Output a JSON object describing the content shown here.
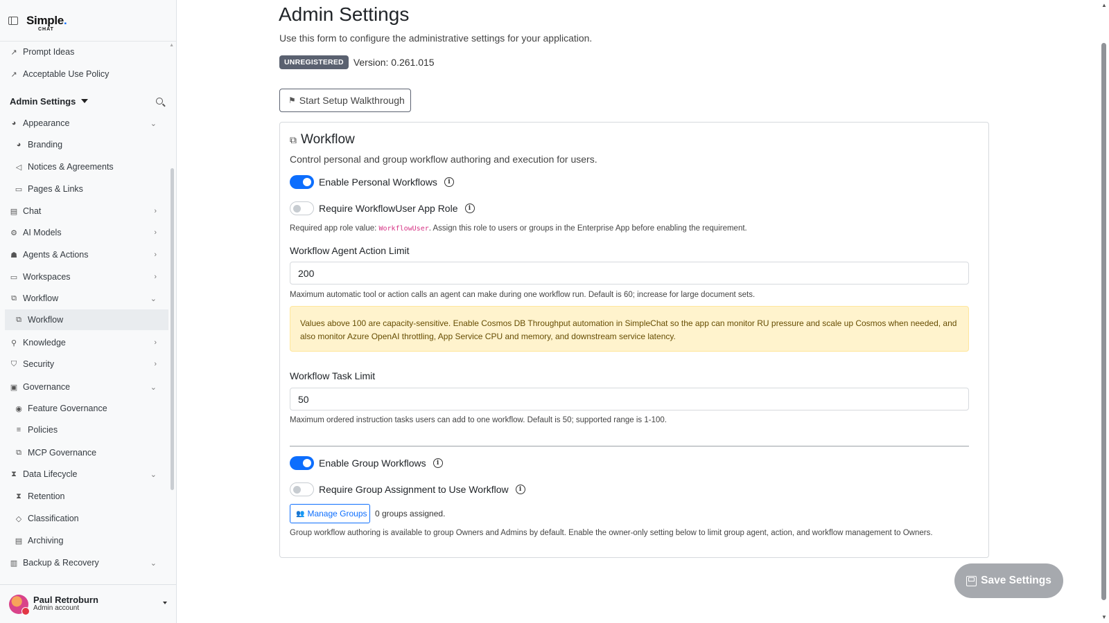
{
  "brand": {
    "line1": "Simple",
    "line2": "CHAT"
  },
  "sidebar": {
    "top_links": [
      {
        "label": "Prompt Ideas",
        "icon": "external-link-icon"
      },
      {
        "label": "Acceptable Use Policy",
        "icon": "external-link-icon"
      }
    ],
    "section_title": "Admin Settings",
    "items": [
      {
        "label": "Appearance",
        "icon": "palette-icon",
        "chevron": "down"
      },
      {
        "label": "Branding",
        "icon": "palette-icon"
      },
      {
        "label": "Notices & Agreements",
        "icon": "megaphone-icon"
      },
      {
        "label": "Pages & Links",
        "icon": "pages-icon"
      },
      {
        "label": "Chat",
        "icon": "chat-icon",
        "chevron": "right"
      },
      {
        "label": "AI Models",
        "icon": "cpu-icon",
        "chevron": "right"
      },
      {
        "label": "Agents & Actions",
        "icon": "robot-icon",
        "chevron": "right"
      },
      {
        "label": "Workspaces",
        "icon": "folder-icon",
        "chevron": "right"
      },
      {
        "label": "Workflow",
        "icon": "workflow-icon",
        "chevron": "down"
      },
      {
        "label": "Workflow",
        "icon": "workflow-icon",
        "active": true
      },
      {
        "label": "Knowledge",
        "icon": "search-icon",
        "chevron": "right"
      },
      {
        "label": "Security",
        "icon": "shield-icon",
        "chevron": "right"
      },
      {
        "label": "Governance",
        "icon": "clipboard-icon",
        "chevron": "down"
      },
      {
        "label": "Feature Governance",
        "icon": "broadcast-icon"
      },
      {
        "label": "Policies",
        "icon": "sliders-icon"
      },
      {
        "label": "MCP Governance",
        "icon": "workflow-icon"
      },
      {
        "label": "Data Lifecycle",
        "icon": "hourglass-icon",
        "chevron": "down"
      },
      {
        "label": "Retention",
        "icon": "hourglass-icon"
      },
      {
        "label": "Classification",
        "icon": "tag-icon"
      },
      {
        "label": "Archiving",
        "icon": "archive-icon"
      },
      {
        "label": "Backup & Recovery",
        "icon": "database-icon",
        "chevron": "down"
      }
    ]
  },
  "user": {
    "name": "Paul Retroburn",
    "role": "Admin account"
  },
  "page": {
    "title": "Admin Settings",
    "description": "Use this form to configure the administrative settings for your application.",
    "badge": "UNREGISTERED",
    "version": "Version: 0.261.015",
    "walkthrough_label": "Start Setup Walkthrough"
  },
  "workflow_card": {
    "title": "Workflow",
    "description": "Control personal and group workflow authoring and execution for users.",
    "enable_personal": {
      "label": "Enable Personal Workflows",
      "checked": true
    },
    "require_role": {
      "label": "Require WorkflowUser App Role",
      "checked": false
    },
    "role_help_prefix": "Required app role value: ",
    "role_value": "WorkflowUser",
    "role_help_suffix": ". Assign this role to users or groups in the Enterprise App before enabling the requirement.",
    "action_limit_label": "Workflow Agent Action Limit",
    "action_limit_value": "200",
    "action_limit_help": "Maximum automatic tool or action calls an agent can make during one workflow run. Default is 60; increase for large document sets.",
    "alert_text": "Values above 100 are capacity-sensitive. Enable Cosmos DB Throughput automation in SimpleChat so the app can monitor RU pressure and scale up Cosmos when needed, and also monitor Azure OpenAI throttling, App Service CPU and memory, and downstream service latency.",
    "task_limit_label": "Workflow Task Limit",
    "task_limit_value": "50",
    "task_limit_help": "Maximum ordered instruction tasks users can add to one workflow. Default is 50; supported range is 1-100.",
    "enable_group": {
      "label": "Enable Group Workflows",
      "checked": true
    },
    "require_group": {
      "label": "Require Group Assignment to Use Workflow",
      "checked": false
    },
    "manage_groups_label": "Manage Groups",
    "groups_assigned": "0 groups assigned.",
    "group_help": "Group workflow authoring is available to group Owners and Admins by default. Enable the owner-only setting below to limit group agent, action, and workflow management to Owners."
  },
  "save_label": "Save Settings",
  "colors": {
    "primary": "#0d6efd",
    "badge": "#5a6170",
    "alert_bg": "#fff3cd",
    "alert_text": "#664d03"
  }
}
